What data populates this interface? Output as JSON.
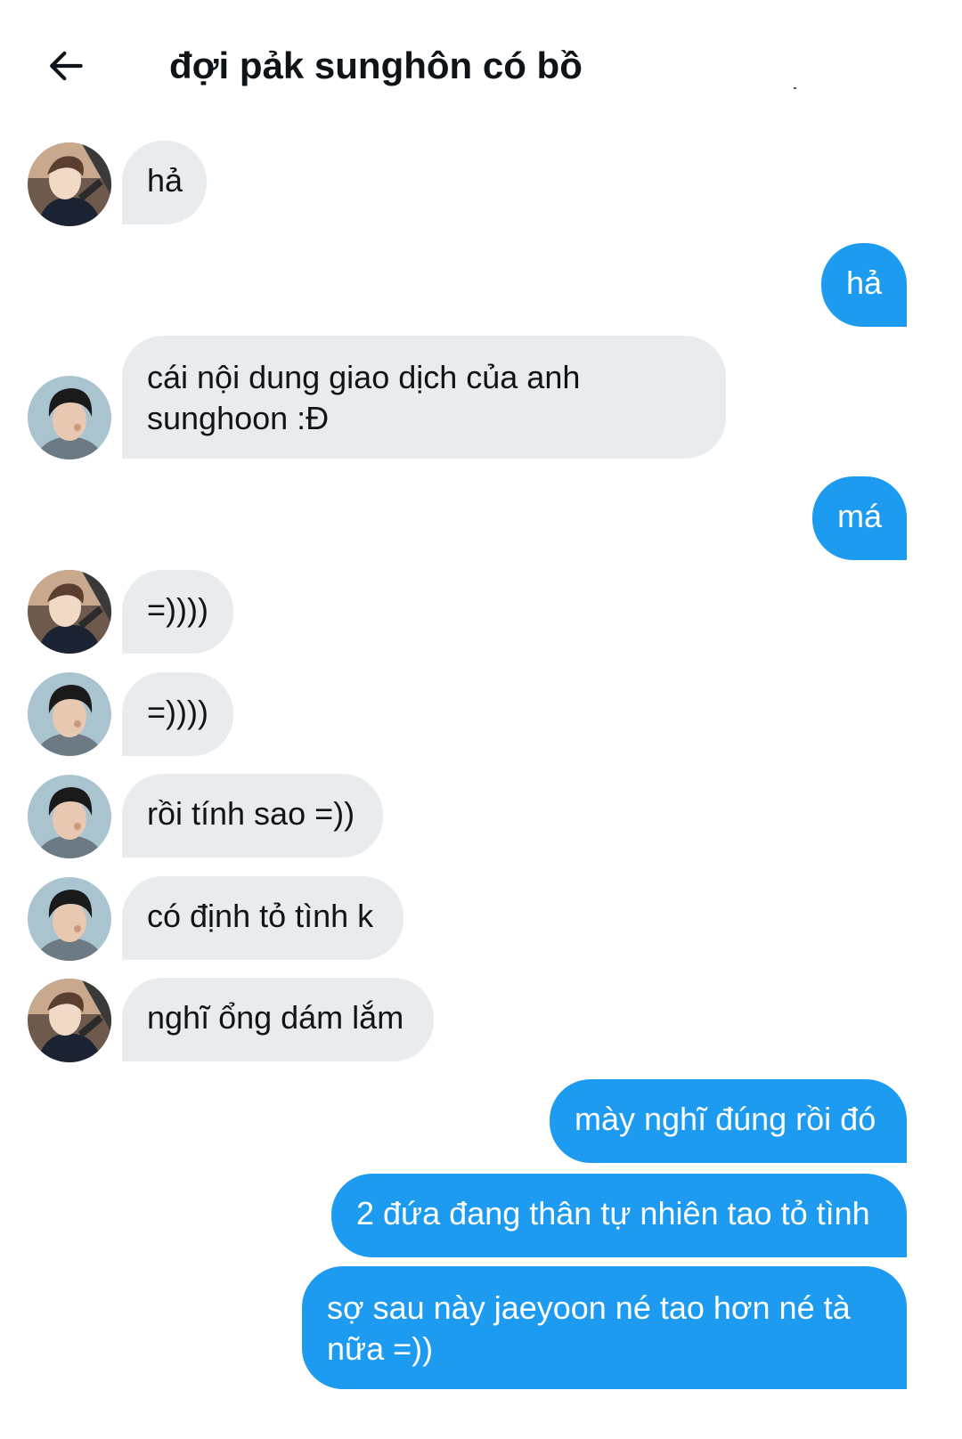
{
  "header": {
    "title": "đợi pảk sunghôn có bồ",
    "back_icon": "arrow-left-icon"
  },
  "colors": {
    "outgoing_bubble": "#1d9bf0",
    "incoming_bubble": "#e8ecef",
    "text": "#0f1419"
  },
  "messages": [
    {
      "direction": "in",
      "avatar": "avatar-1",
      "text": "hả"
    },
    {
      "direction": "out",
      "text": "hả"
    },
    {
      "direction": "in",
      "avatar": "avatar-2",
      "text": "cái nội dung giao dịch của anh sunghoon :Đ"
    },
    {
      "direction": "out",
      "text": "má"
    },
    {
      "direction": "in",
      "avatar": "avatar-1",
      "text": "=))))"
    },
    {
      "direction": "in",
      "avatar": "avatar-2",
      "text": "=))))"
    },
    {
      "direction": "in",
      "avatar": "avatar-2",
      "text": "rồi tính sao =))"
    },
    {
      "direction": "in",
      "avatar": "avatar-2",
      "text": "có định tỏ tình k"
    },
    {
      "direction": "in",
      "avatar": "avatar-1",
      "text": "nghĩ ổng dám lắm"
    },
    {
      "direction": "out",
      "text": "mày nghĩ đúng rồi đó"
    },
    {
      "direction": "out",
      "text": "2 đứa đang thân tự nhiên tao tỏ tình"
    },
    {
      "direction": "out",
      "text": "sợ sau này jaeyoon né tao hơn né tà nữa =))"
    }
  ]
}
